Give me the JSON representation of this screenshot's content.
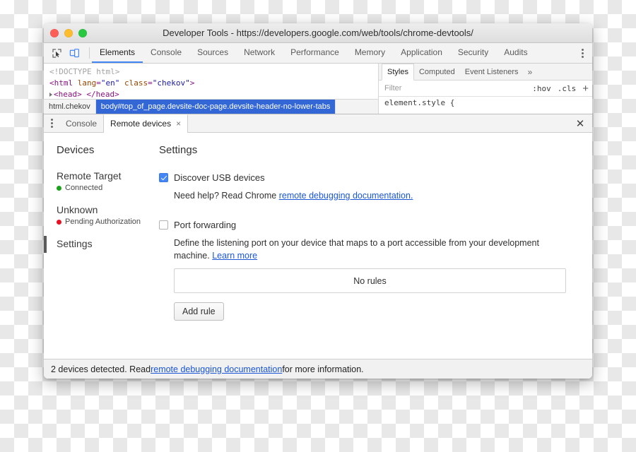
{
  "window": {
    "title": "Developer Tools - https://developers.google.com/web/tools/chrome-devtools/",
    "traffic_lights": [
      "close",
      "minimize",
      "zoom"
    ],
    "colors": {
      "close": "#ff5f57",
      "minimize": "#ffbd2e",
      "zoom": "#28c840",
      "accent": "#4285f4",
      "link": "#1a56d6",
      "crumb_selected": "#3367d6",
      "connected": "#1aa21a",
      "pending": "#e81123"
    }
  },
  "toolbar": {
    "icons": [
      {
        "name": "inspect-element-icon",
        "active": false
      },
      {
        "name": "device-toolbar-icon",
        "active": true
      }
    ],
    "tabs": [
      {
        "label": "Elements",
        "active": true
      },
      {
        "label": "Console",
        "active": false
      },
      {
        "label": "Sources",
        "active": false
      },
      {
        "label": "Network",
        "active": false
      },
      {
        "label": "Performance",
        "active": false
      },
      {
        "label": "Memory",
        "active": false
      },
      {
        "label": "Application",
        "active": false
      },
      {
        "label": "Security",
        "active": false
      },
      {
        "label": "Audits",
        "active": false
      }
    ],
    "more_label": "⋮"
  },
  "elements_panel": {
    "dom_lines": [
      {
        "type": "comment",
        "text": "<!DOCTYPE html>"
      },
      {
        "type": "tag_open",
        "text": "<html lang=\"en\" class=\"chekov\">"
      },
      {
        "type": "collapsed",
        "text": "<head> </head>"
      }
    ],
    "dom_line_1": "<!DOCTYPE html>",
    "dom_line_2_tag": "html",
    "dom_line_2_attr1": "lang",
    "dom_line_2_val1": "\"en\"",
    "dom_line_2_attr2": "class",
    "dom_line_2_val2": "\"chekov\"",
    "dom_line_3": "<head> </head>",
    "breadcrumbs": [
      {
        "label": "html.chekov",
        "selected": false
      },
      {
        "label": "body#top_of_page.devsite-doc-page.devsite-header-no-lower-tabs",
        "selected": true
      }
    ]
  },
  "styles_panel": {
    "tabs": [
      {
        "label": "Styles",
        "active": true
      },
      {
        "label": "Computed",
        "active": false
      },
      {
        "label": "Event Listeners",
        "active": false
      }
    ],
    "more_label": "»",
    "filter_placeholder": "Filter",
    "hov_label": ":hov",
    "cls_label": ".cls",
    "add_label": "+",
    "rule_preview": "element.style {"
  },
  "drawer": {
    "menu_label": "⋮",
    "tabs": [
      {
        "label": "Console",
        "active": false,
        "closeable": false
      },
      {
        "label": "Remote devices",
        "active": true,
        "closeable": true
      }
    ],
    "tab_close_label": "×",
    "close_label": "✕"
  },
  "remote_devices": {
    "sidebar": {
      "heading": "Devices",
      "items": [
        {
          "name": "Remote Target",
          "status": "Connected",
          "status_color": "green",
          "selected": false
        },
        {
          "name": "Unknown",
          "status": "Pending Authorization",
          "status_color": "red",
          "selected": false
        }
      ],
      "settings_label": "Settings",
      "settings_selected": true
    },
    "settings": {
      "title": "Settings",
      "discover_usb": {
        "label": "Discover USB devices",
        "checked": true,
        "help_prefix": "Need help? Read Chrome ",
        "help_link": "remote debugging documentation."
      },
      "port_forwarding": {
        "label": "Port forwarding",
        "checked": false,
        "description": "Define the listening port on your device that maps to a port accessible from your development machine. ",
        "description_link": "Learn more",
        "no_rules_label": "No rules",
        "add_rule_label": "Add rule"
      }
    }
  },
  "statusbar": {
    "prefix": "2 devices detected. Read ",
    "link": "remote debugging documentation",
    "suffix": " for more information."
  }
}
